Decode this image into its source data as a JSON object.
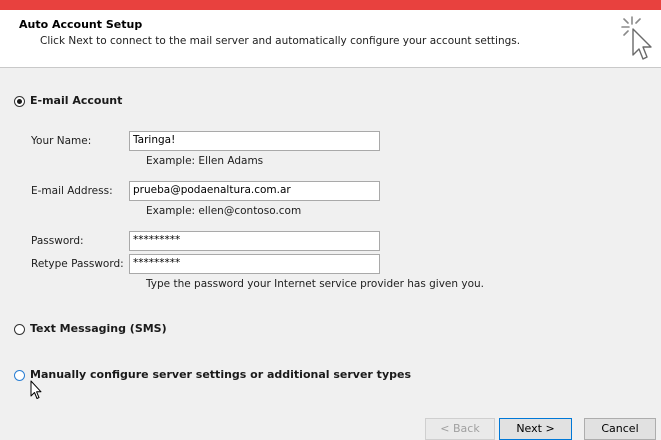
{
  "header": {
    "title": "Auto Account Setup",
    "subtitle": "Click Next to connect to the mail server and automatically configure your account settings.",
    "icon": "wizard-cursor-icon"
  },
  "options": {
    "email_account": {
      "label": "E-mail Account",
      "selected": true
    },
    "text_messaging": {
      "label": "Text Messaging (SMS)",
      "selected": false
    },
    "manual": {
      "label": "Manually configure server settings or additional server types",
      "selected": false
    }
  },
  "form": {
    "name": {
      "label": "Your Name:",
      "value": "Taringa!",
      "hint": "Example: Ellen Adams"
    },
    "email": {
      "label": "E-mail Address:",
      "value": "prueba@podaenaltura.com.ar",
      "hint": "Example: ellen@contoso.com"
    },
    "password": {
      "label": "Password:",
      "value": "*********"
    },
    "retype_password": {
      "label": "Retype Password:",
      "value": "*********"
    },
    "password_hint": "Type the password your Internet service provider has given you."
  },
  "buttons": {
    "back": "< Back",
    "next": "Next >",
    "cancel": "Cancel"
  },
  "colors": {
    "top_bar": "#e8413e",
    "default_button_border": "#0078d7"
  }
}
